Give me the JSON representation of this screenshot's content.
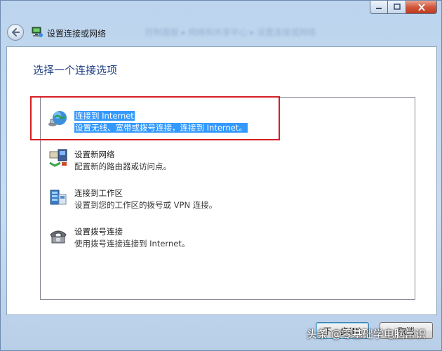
{
  "window": {
    "title": "设置连接或网络",
    "blurred_path_text": "控制面板 ▸ 网络和共享中心 ▸ 设置连接或网络"
  },
  "heading": "选择一个连接选项",
  "options": [
    {
      "title": "连接到 Internet",
      "description": "设置无线、宽带或拨号连接，连接到 Internet。",
      "icon": "globe-network-icon",
      "selected": true
    },
    {
      "title": "设置新网络",
      "description": "配置新的路由器或访问点。",
      "icon": "router-icon",
      "selected": false
    },
    {
      "title": "连接到工作区",
      "description": "设置到您的工作区的拨号或 VPN 连接。",
      "icon": "workplace-server-icon",
      "selected": false
    },
    {
      "title": "设置拨号连接",
      "description": "使用拨号连接连接到 Internet。",
      "icon": "dialup-phone-icon",
      "selected": false
    }
  ],
  "buttons": {
    "next": "下一步(N)",
    "cancel": "取消"
  },
  "watermark": "头条 @零基础学电脑常识",
  "colors": {
    "selection": "#3399ff",
    "highlight_frame": "#d51e25",
    "heading": "#1f3f84"
  }
}
